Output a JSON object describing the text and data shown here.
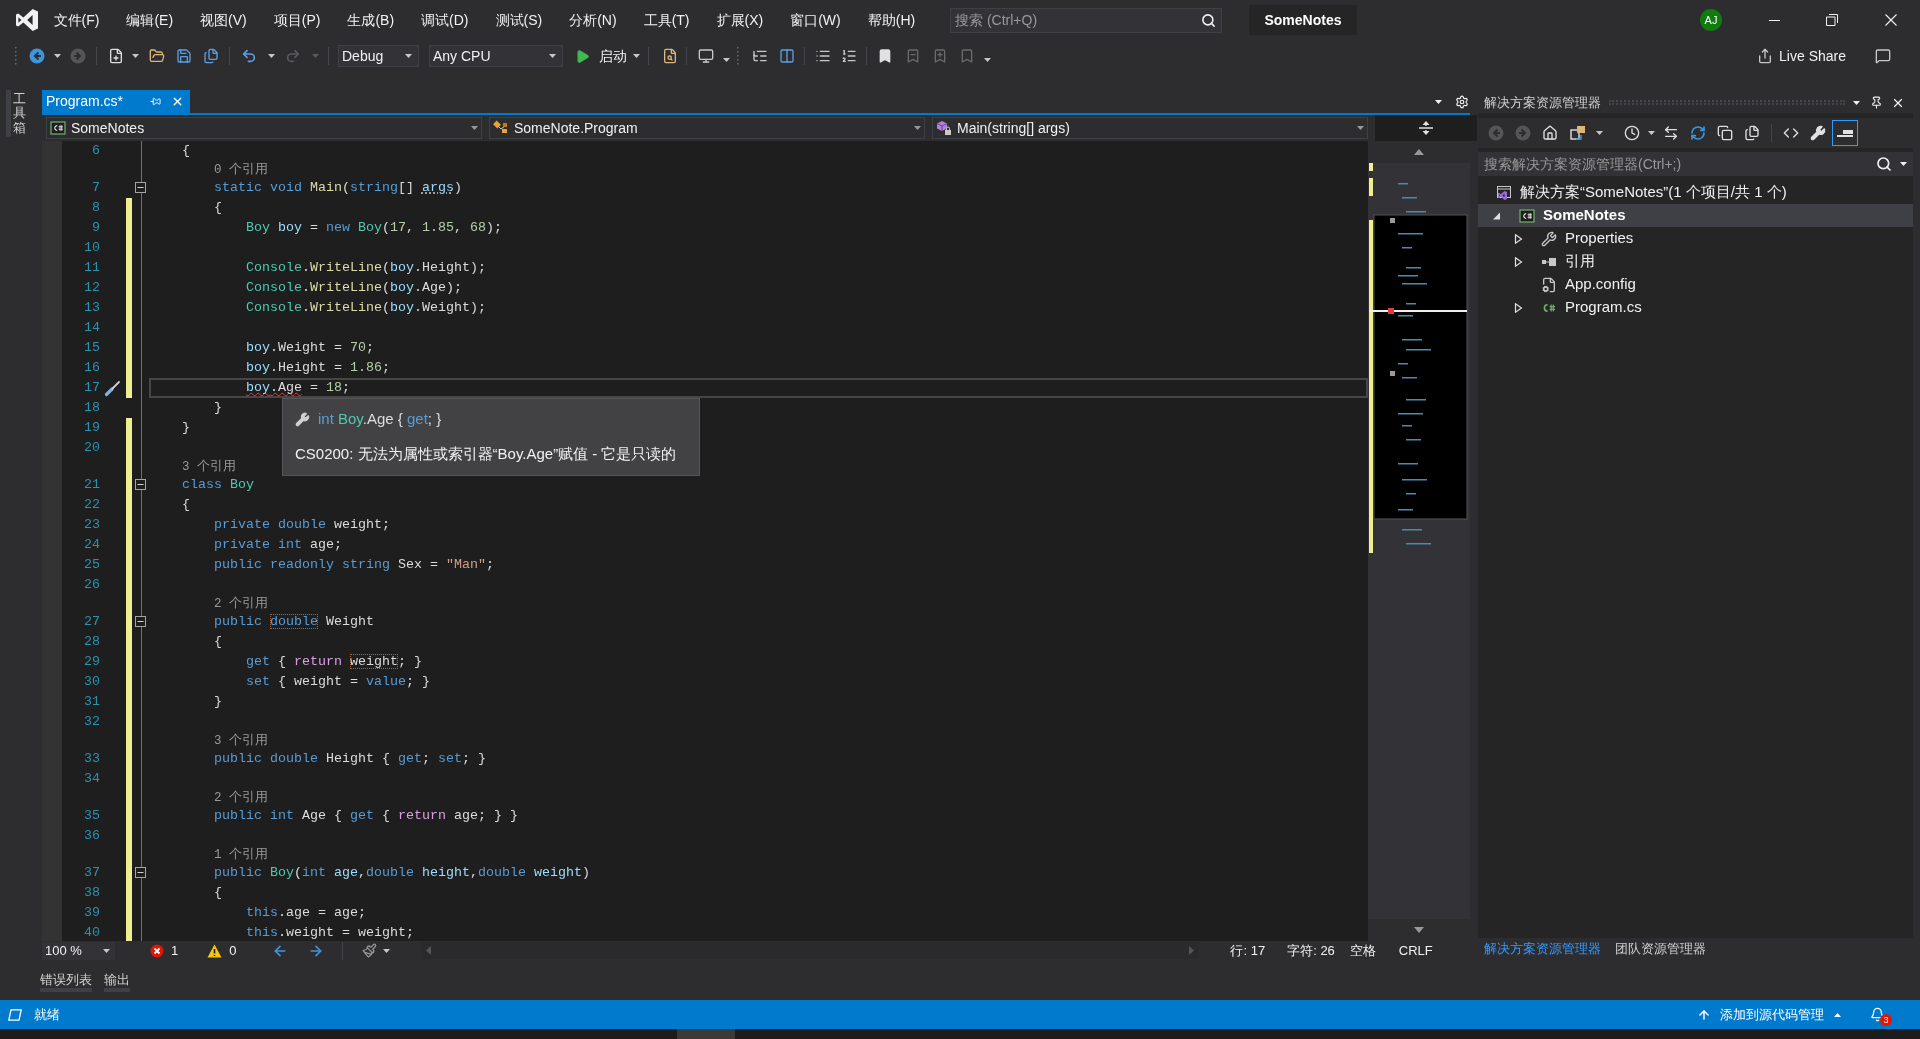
{
  "title_bar": {
    "menu": [
      "文件(F)",
      "编辑(E)",
      "视图(V)",
      "项目(P)",
      "生成(B)",
      "调试(D)",
      "测试(S)",
      "分析(N)",
      "工具(T)",
      "扩展(X)",
      "窗口(W)",
      "帮助(H)"
    ],
    "search": {
      "placeholder": "搜索 (Ctrl+Q)"
    },
    "title": "SomeNotes",
    "avatar": "AJ"
  },
  "toolbar": {
    "configuration": "Debug",
    "platform": "Any CPU",
    "start": "启动",
    "live_share": "Live Share"
  },
  "toolbox_tab": "工具箱",
  "editor": {
    "tabs": [
      {
        "label": "Program.cs*",
        "selected": true
      }
    ],
    "navigation": [
      {
        "text": "SomeNotes",
        "kind": "project"
      },
      {
        "text": "SomeNote.Program",
        "kind": "class"
      },
      {
        "text": "Main(string[] args)",
        "kind": "method"
      }
    ],
    "lines": [
      {
        "kind": "code",
        "number": "6",
        "modified": false,
        "tokens": [
          {
            "text": "    {",
            "kind": "plain"
          }
        ]
      },
      {
        "kind": "codelens",
        "text": "        0 个引用",
        "modified": false
      },
      {
        "kind": "code",
        "number": "7",
        "modified": false,
        "expanded": true,
        "tokens": [
          {
            "text": "        static void",
            "kind": "keyword"
          },
          {
            "text": " Main",
            "kind": "method"
          },
          {
            "text": "(",
            "kind": "plain"
          },
          {
            "text": "string",
            "kind": "keyword"
          },
          {
            "text": "[] ",
            "kind": "plain"
          },
          {
            "text": "args",
            "kind": "variable",
            "unused": true
          },
          {
            "text": ")",
            "kind": "plain"
          }
        ]
      },
      {
        "kind": "code",
        "number": "8",
        "modified": true,
        "tokens": [
          {
            "text": "        {",
            "kind": "plain"
          }
        ]
      },
      {
        "kind": "code",
        "number": "9",
        "modified": true,
        "tokens": [
          {
            "text": "            Boy",
            "kind": "type"
          },
          {
            "text": " boy",
            "kind": "variable"
          },
          {
            "text": " = ",
            "kind": "plain"
          },
          {
            "text": "new",
            "kind": "keyword"
          },
          {
            "text": " Boy",
            "kind": "type"
          },
          {
            "text": "(",
            "kind": "plain"
          },
          {
            "text": "17",
            "kind": "number"
          },
          {
            "text": ", ",
            "kind": "plain"
          },
          {
            "text": "1.85",
            "kind": "number"
          },
          {
            "text": ", ",
            "kind": "plain"
          },
          {
            "text": "68",
            "kind": "number"
          },
          {
            "text": ");",
            "kind": "plain"
          }
        ]
      },
      {
        "kind": "code",
        "number": "10",
        "modified": true
      },
      {
        "kind": "code",
        "number": "11",
        "modified": true,
        "tokens": [
          {
            "text": "            Console",
            "kind": "type"
          },
          {
            "text": ".",
            "kind": "plain"
          },
          {
            "text": "WriteLine",
            "kind": "method"
          },
          {
            "text": "(",
            "kind": "plain"
          },
          {
            "text": "boy",
            "kind": "variable"
          },
          {
            "text": ".Height);",
            "kind": "plain"
          }
        ]
      },
      {
        "kind": "code",
        "number": "12",
        "modified": true,
        "tokens": [
          {
            "text": "            Console",
            "kind": "type"
          },
          {
            "text": ".",
            "kind": "plain"
          },
          {
            "text": "WriteLine",
            "kind": "method"
          },
          {
            "text": "(",
            "kind": "plain"
          },
          {
            "text": "boy",
            "kind": "variable"
          },
          {
            "text": ".Age);",
            "kind": "plain"
          }
        ]
      },
      {
        "kind": "code",
        "number": "13",
        "modified": true,
        "tokens": [
          {
            "text": "            Console",
            "kind": "type"
          },
          {
            "text": ".",
            "kind": "plain"
          },
          {
            "text": "WriteLine",
            "kind": "method"
          },
          {
            "text": "(",
            "kind": "plain"
          },
          {
            "text": "boy",
            "kind": "variable"
          },
          {
            "text": ".Weight);",
            "kind": "plain"
          }
        ]
      },
      {
        "kind": "code",
        "number": "14",
        "modified": true
      },
      {
        "kind": "code",
        "number": "15",
        "modified": true,
        "tokens": [
          {
            "text": "            boy",
            "kind": "variable"
          },
          {
            "text": ".Weight = ",
            "kind": "plain"
          },
          {
            "text": "70",
            "kind": "number"
          },
          {
            "text": ";",
            "kind": "plain"
          }
        ]
      },
      {
        "kind": "code",
        "number": "16",
        "modified": true,
        "tokens": [
          {
            "text": "            boy",
            "kind": "variable"
          },
          {
            "text": ".Height = ",
            "kind": "plain"
          },
          {
            "text": "1.86",
            "kind": "number"
          },
          {
            "text": ";",
            "kind": "plain"
          }
        ]
      },
      {
        "kind": "code",
        "number": "17",
        "modified": true,
        "current": true,
        "quick_action": true,
        "tokens": [
          {
            "text": "            boy",
            "kind": "variable",
            "error": true
          },
          {
            "text": ".Age",
            "kind": "plain",
            "error": true
          },
          {
            "text": " = ",
            "kind": "plain"
          },
          {
            "text": "18",
            "kind": "number"
          },
          {
            "text": ";",
            "kind": "plain"
          }
        ]
      },
      {
        "kind": "code",
        "number": "18",
        "modified": false,
        "tokens": [
          {
            "text": "        }",
            "kind": "plain"
          }
        ]
      },
      {
        "kind": "code",
        "number": "19",
        "modified": true,
        "tokens": [
          {
            "text": "    }",
            "kind": "plain"
          }
        ]
      },
      {
        "kind": "code",
        "number": "20",
        "modified": true
      },
      {
        "kind": "codelens",
        "text": "    3 个引用",
        "modified": true
      },
      {
        "kind": "code",
        "number": "21",
        "modified": true,
        "expanded": true,
        "tokens": [
          {
            "text": "    class",
            "kind": "keyword"
          },
          {
            "text": " Boy",
            "kind": "type"
          }
        ]
      },
      {
        "kind": "code",
        "number": "22",
        "modified": true,
        "tokens": [
          {
            "text": "    {",
            "kind": "plain"
          }
        ]
      },
      {
        "kind": "code",
        "number": "23",
        "modified": true,
        "tokens": [
          {
            "text": "        private double",
            "kind": "keyword"
          },
          {
            "text": " weight;",
            "kind": "plain"
          }
        ]
      },
      {
        "kind": "code",
        "number": "24",
        "modified": true,
        "tokens": [
          {
            "text": "        private int",
            "kind": "keyword"
          },
          {
            "text": " age;",
            "kind": "plain"
          }
        ]
      },
      {
        "kind": "code",
        "number": "25",
        "modified": true,
        "tokens": [
          {
            "text": "        public readonly string",
            "kind": "keyword"
          },
          {
            "text": " Sex = ",
            "kind": "plain"
          },
          {
            "text": "\"Man\"",
            "kind": "string"
          },
          {
            "text": ";",
            "kind": "plain"
          }
        ]
      },
      {
        "kind": "code",
        "number": "26",
        "modified": true
      },
      {
        "kind": "codelens",
        "text": "        2 个引用",
        "modified": true
      },
      {
        "kind": "code",
        "number": "27",
        "modified": true,
        "expanded": true,
        "tokens": [
          {
            "text": "        public ",
            "kind": "keyword"
          },
          {
            "text": "double",
            "kind": "keyword",
            "outlined": true
          },
          {
            "text": " Weight",
            "kind": "plain"
          }
        ]
      },
      {
        "kind": "code",
        "number": "28",
        "modified": true,
        "tokens": [
          {
            "text": "        {",
            "kind": "plain"
          }
        ]
      },
      {
        "kind": "code",
        "number": "29",
        "modified": true,
        "tokens": [
          {
            "text": "            get",
            "kind": "keyword"
          },
          {
            "text": " { ",
            "kind": "plain"
          },
          {
            "text": "return ",
            "kind": "control"
          },
          {
            "text": "weight",
            "kind": "plain",
            "outlined": true
          },
          {
            "text": "; }",
            "kind": "plain"
          }
        ]
      },
      {
        "kind": "code",
        "number": "30",
        "modified": true,
        "tokens": [
          {
            "text": "            set",
            "kind": "keyword"
          },
          {
            "text": " { weight = ",
            "kind": "plain"
          },
          {
            "text": "value",
            "kind": "keyword"
          },
          {
            "text": "; }",
            "kind": "plain"
          }
        ]
      },
      {
        "kind": "code",
        "number": "31",
        "modified": true,
        "tokens": [
          {
            "text": "        }",
            "kind": "plain"
          }
        ]
      },
      {
        "kind": "code",
        "number": "32",
        "modified": true
      },
      {
        "kind": "codelens",
        "text": "        3 个引用",
        "modified": true
      },
      {
        "kind": "code",
        "number": "33",
        "modified": true,
        "tokens": [
          {
            "text": "        public double",
            "kind": "keyword"
          },
          {
            "text": " Height { ",
            "kind": "plain"
          },
          {
            "text": "get",
            "kind": "keyword"
          },
          {
            "text": "; ",
            "kind": "plain"
          },
          {
            "text": "set",
            "kind": "keyword"
          },
          {
            "text": "; }",
            "kind": "plain"
          }
        ]
      },
      {
        "kind": "code",
        "number": "34",
        "modified": true
      },
      {
        "kind": "codelens",
        "text": "        2 个引用",
        "modified": true
      },
      {
        "kind": "code",
        "number": "35",
        "modified": true,
        "tokens": [
          {
            "text": "        public int",
            "kind": "keyword"
          },
          {
            "text": " Age { ",
            "kind": "plain"
          },
          {
            "text": "get",
            "kind": "keyword"
          },
          {
            "text": " { ",
            "kind": "plain"
          },
          {
            "text": "return",
            "kind": "control"
          },
          {
            "text": " age; } }",
            "kind": "plain"
          }
        ]
      },
      {
        "kind": "code",
        "number": "36",
        "modified": true
      },
      {
        "kind": "codelens",
        "text": "        1 个引用",
        "modified": true
      },
      {
        "kind": "code",
        "number": "37",
        "modified": true,
        "expanded": true,
        "tokens": [
          {
            "text": "        public",
            "kind": "keyword"
          },
          {
            "text": " Boy",
            "kind": "type"
          },
          {
            "text": "(",
            "kind": "plain"
          },
          {
            "text": "int",
            "kind": "keyword"
          },
          {
            "text": " age",
            "kind": "variable"
          },
          {
            "text": ",",
            "kind": "plain"
          },
          {
            "text": "double",
            "kind": "keyword"
          },
          {
            "text": " height",
            "kind": "variable"
          },
          {
            "text": ",",
            "kind": "plain"
          },
          {
            "text": "double",
            "kind": "keyword"
          },
          {
            "text": " weight",
            "kind": "variable"
          },
          {
            "text": ")",
            "kind": "plain"
          }
        ]
      },
      {
        "kind": "code",
        "number": "38",
        "modified": true,
        "tokens": [
          {
            "text": "        {",
            "kind": "plain"
          }
        ]
      },
      {
        "kind": "code",
        "number": "39",
        "modified": true,
        "tokens": [
          {
            "text": "            this",
            "kind": "keyword"
          },
          {
            "text": ".age = age;",
            "kind": "plain"
          }
        ]
      },
      {
        "kind": "code",
        "number": "40",
        "modified": true,
        "tokens": [
          {
            "text": "            this",
            "kind": "keyword"
          },
          {
            "text": ".weight = weight;",
            "kind": "plain"
          }
        ]
      }
    ],
    "quick_info": {
      "signature": [
        {
          "text": "int",
          "kind": "keyword"
        },
        {
          "text": " Boy",
          "kind": "type"
        },
        {
          "text": ".Age { ",
          "kind": "plain"
        },
        {
          "text": "get",
          "kind": "keyword"
        },
        {
          "text": "; }",
          "kind": "plain"
        }
      ],
      "message": "CS0200: 无法为属性或索引器“Boy.Age”赋值 - 它是只读的"
    },
    "status": {
      "zoom": "100 %",
      "errors": "1",
      "warnings": "0",
      "line": "行: 17",
      "column": "字符: 26",
      "indent": "空格",
      "line_ending": "CRLF"
    }
  },
  "solution_explorer": {
    "title": "解决方案资源管理器",
    "search": {
      "placeholder": "搜索解决方案资源管理器(Ctrl+;)"
    },
    "tree": [
      {
        "label": "解决方案“SomeNotes”(1 个项目/共 1 个)",
        "kind": "solution",
        "selected": false,
        "children": [
          {
            "label": "SomeNotes",
            "kind": "project",
            "selected": true,
            "expanded": true,
            "children": [
              {
                "label": "Properties",
                "kind": "properties",
                "selected": false,
                "expanded": false
              },
              {
                "label": "引用",
                "kind": "references",
                "selected": false,
                "expanded": false
              },
              {
                "label": "App.config",
                "kind": "config",
                "selected": false
              },
              {
                "label": "Program.cs",
                "kind": "csharp_file",
                "selected": false,
                "expanded": false
              }
            ]
          }
        ]
      }
    ],
    "tabs": [
      {
        "label": "解决方案资源管理器",
        "selected": true
      },
      {
        "label": "团队资源管理器",
        "selected": false
      }
    ]
  },
  "tool_windows": [
    "错误列表",
    "输出"
  ],
  "status_bar": {
    "message": "就绪",
    "source_control": "添加到源代码管理",
    "notifications": "3"
  }
}
